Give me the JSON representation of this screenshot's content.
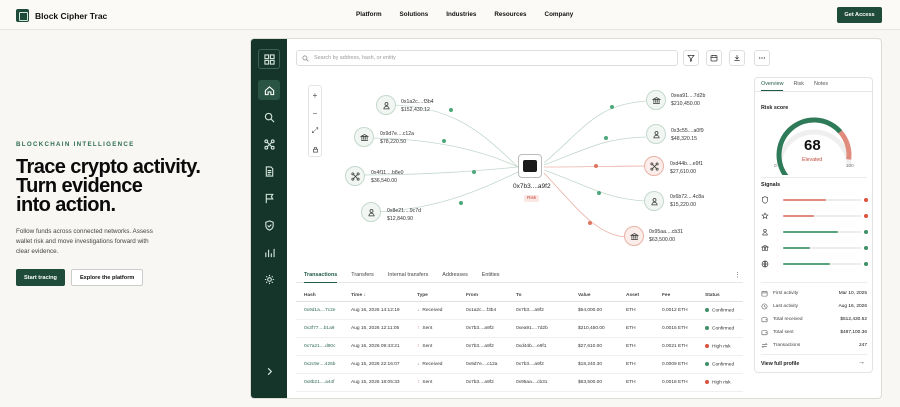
{
  "brand": {
    "name": "Block Cipher Trac"
  },
  "nav": {
    "links": [
      "Platform",
      "Solutions",
      "Industries",
      "Resources",
      "Company"
    ],
    "cta": "Get Access"
  },
  "hero": {
    "eyebrow": "BLOCKCHAIN INTELLIGENCE",
    "title_lines": [
      "Trace crypto activity.",
      "Turn evidence",
      "into action."
    ],
    "subtitle": "Follow funds across connected networks. Assess wallet risk and move investigations forward with clear evidence.",
    "primary_button": "Start tracing",
    "secondary_button": "Explore the platform"
  },
  "app": {
    "search_placeholder": "Search by address, hash, or entity",
    "rail_icons": [
      "grid-icon",
      "home-icon",
      "search-icon",
      "network-icon",
      "document-icon",
      "flag-icon",
      "shield-icon",
      "bar-chart-icon",
      "settings-icon",
      "chevron-right-icon"
    ],
    "toolbar_icons": [
      "filter-icon",
      "calendar-icon",
      "download-icon",
      "more-icon"
    ],
    "zoom_controls": [
      "+",
      "−",
      "⤢",
      "🔒"
    ],
    "graph": {
      "center": {
        "address": "0x7b3....a9f2",
        "badge": "Risk"
      },
      "left_nodes": [
        {
          "address": "0x1a2c....f3b4",
          "value": "$152,430.12",
          "icon": "user-icon"
        },
        {
          "address": "0x9d7e....c12a",
          "value": "$78,220.50",
          "icon": "bank-icon"
        },
        {
          "address": "0x4f11....b8e0",
          "value": "$36,540.00",
          "icon": "network-icon"
        },
        {
          "address": "0x8e21....9c7d",
          "value": "$12,840.90",
          "icon": "user-icon"
        }
      ],
      "right_nodes": [
        {
          "address": "0xea91....7d2b",
          "value": "$210,450.00",
          "icon": "bank-icon",
          "risk": false
        },
        {
          "address": "0x3c55....a0f9",
          "value": "$48,320.15",
          "icon": "user-icon",
          "risk": false
        },
        {
          "address": "0xd44b....e9f1",
          "value": "$27,610.00",
          "icon": "network-icon",
          "risk": true
        },
        {
          "address": "0x6b72....4c8a",
          "value": "$15,220.00",
          "icon": "user-icon",
          "risk": false
        },
        {
          "address": "0x95aa....cb31",
          "value": "$63,500.00",
          "icon": "bank-icon",
          "risk": true
        }
      ]
    },
    "tabs": [
      "Transactions",
      "Transfers",
      "Internal transfers",
      "Addresses",
      "Entities"
    ],
    "table": {
      "headers": [
        "Hash",
        "Time ↓",
        "Type",
        "From",
        "To",
        "Value",
        "Asset",
        "Fee",
        "Status"
      ],
      "rows": [
        [
          "0x9d1a....7c2e",
          "Aug 16, 2026 14:12:19",
          "Received",
          "0x1a2c....f3b4",
          "0x7b3....a9f2",
          "$54,000.00",
          "ETH",
          "0.0012 ETH",
          "Confirmed"
        ],
        [
          "0x3f77....b1a9",
          "Aug 16, 2026 12:11:05",
          "Sent",
          "0x7b3....a9f2",
          "0xea91....7d2b",
          "$210,450.00",
          "ETH",
          "0.0015 ETH",
          "Confirmed"
        ],
        [
          "0x7a21....d90c",
          "Aug 16, 2026 09:43:21",
          "Sent",
          "0x7b3....a9f2",
          "0xd44b....e9f1",
          "$27,610.00",
          "ETH",
          "0.0021 ETH",
          "High risk"
        ],
        [
          "0x2c9e....426b",
          "Aug 15, 2026 22:16:07",
          "Received",
          "0x9d7e....c12a",
          "0x7b3....a9f2",
          "$18,240.30",
          "ETH",
          "0.0009 ETH",
          "Confirmed"
        ],
        [
          "0x8b21....a44f",
          "Aug 15, 2026 18:05:33",
          "Sent",
          "0x7b3....a9f2",
          "0x95aa....cb31",
          "$63,500.00",
          "ETH",
          "0.0018 ETH",
          "High risk"
        ]
      ]
    },
    "panel": {
      "tabs": [
        "Overview",
        "Risk",
        "Notes"
      ],
      "risk_title": "Risk score",
      "score": "68",
      "score_fraction": 0.68,
      "score_label": "Elevated",
      "min": "0",
      "max": "100",
      "signals_title": "Signals",
      "signals": [
        {
          "icon": "shield-icon",
          "level": 0.55,
          "color": "#e08b7c",
          "dot": "#d9513d"
        },
        {
          "icon": "star-icon",
          "level": 0.4,
          "color": "#e08b7c",
          "dot": "#d9513d"
        },
        {
          "icon": "user-icon",
          "level": 0.7,
          "color": "#5aa37f",
          "dot": "#3f8f68"
        },
        {
          "icon": "bank-icon",
          "level": 0.35,
          "color": "#5aa37f",
          "dot": "#3f8f68"
        },
        {
          "icon": "globe-icon",
          "level": 0.6,
          "color": "#5aa37f",
          "dot": "#3f8f68"
        }
      ],
      "stats": [
        {
          "label": "First activity",
          "value": "Mar 10, 2025",
          "icon": "calendar-icon"
        },
        {
          "label": "Last activity",
          "value": "Aug 16, 2026",
          "icon": "clock-icon"
        },
        {
          "label": "Total received",
          "value": "$512,430.52",
          "icon": "wallet-icon"
        },
        {
          "label": "Total sent",
          "value": "$487,100.36",
          "icon": "wallet-icon"
        },
        {
          "label": "Transactions",
          "value": "247",
          "icon": "swap-icon"
        }
      ],
      "view_profile": "View full profile"
    }
  },
  "colors": {
    "brand": "#1f4b3b",
    "risk": "#d9513d",
    "ok": "#3f8f68"
  }
}
